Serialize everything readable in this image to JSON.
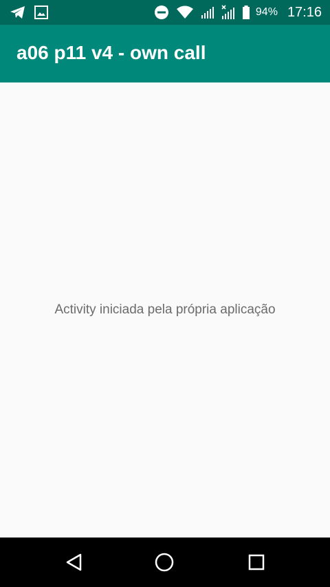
{
  "status_bar": {
    "left_icons": [
      "telegram-icon",
      "image-icon"
    ],
    "right_icons": [
      "do-not-disturb-icon",
      "wifi-icon",
      "signal-icon",
      "no-signal-icon",
      "battery-icon"
    ],
    "battery_percent": "94%",
    "time": "17:16"
  },
  "app_bar": {
    "title": "a06 p11 v4 - own call"
  },
  "content": {
    "message": "Activity iniciada pela própria aplicação"
  },
  "nav_bar": {
    "buttons": [
      "back-icon",
      "home-icon",
      "recents-icon"
    ]
  },
  "colors": {
    "status_bar": "#00695c",
    "app_bar": "#00897b",
    "background": "#fafafa",
    "nav_bar": "#000000"
  }
}
